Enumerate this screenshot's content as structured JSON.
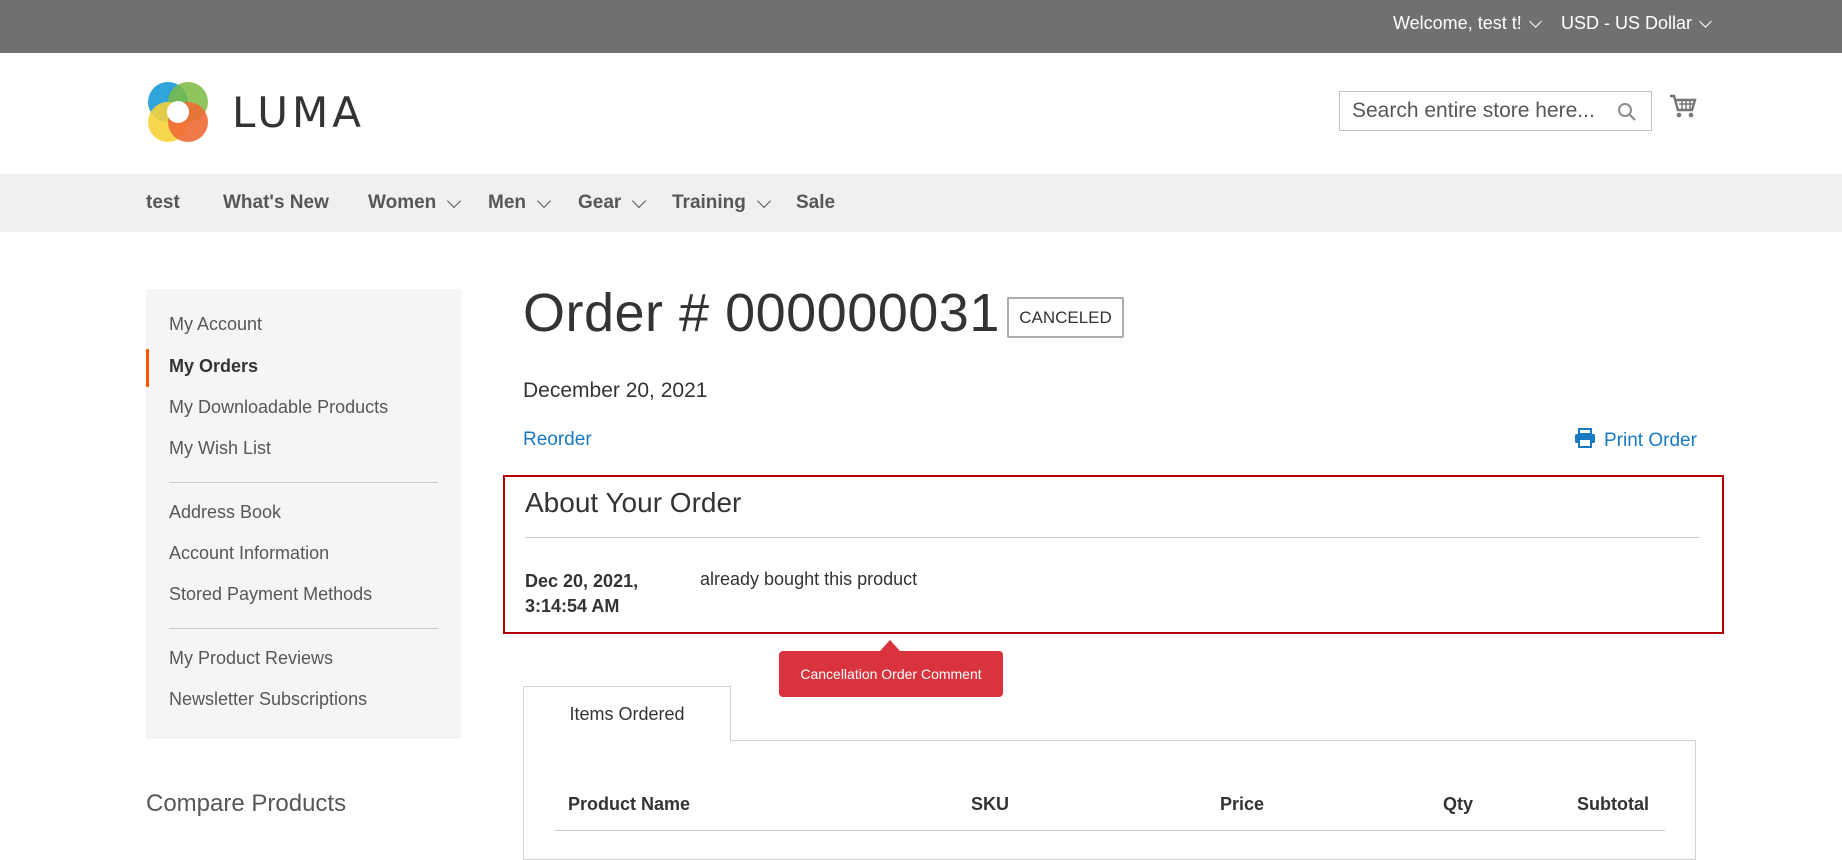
{
  "topbar": {
    "welcome": "Welcome, test t!",
    "currency": "USD - US Dollar"
  },
  "header": {
    "logo_text": "LUMA",
    "search_placeholder": "Search entire store here..."
  },
  "nav": {
    "items": [
      {
        "label": "test",
        "has_submenu": false
      },
      {
        "label": "What's New",
        "has_submenu": false
      },
      {
        "label": "Women",
        "has_submenu": true
      },
      {
        "label": "Men",
        "has_submenu": true
      },
      {
        "label": "Gear",
        "has_submenu": true
      },
      {
        "label": "Training",
        "has_submenu": true
      },
      {
        "label": "Sale",
        "has_submenu": false
      }
    ]
  },
  "sidebar": {
    "items": [
      {
        "label": "My Account"
      },
      {
        "label": "My Orders",
        "active": true
      },
      {
        "label": "My Downloadable Products"
      },
      {
        "label": "My Wish List"
      },
      {
        "label": "Address Book"
      },
      {
        "label": "Account Information"
      },
      {
        "label": "Stored Payment Methods"
      },
      {
        "label": "My Product Reviews"
      },
      {
        "label": "Newsletter Subscriptions"
      }
    ],
    "compare_title": "Compare Products"
  },
  "order": {
    "title": "Order # 000000031",
    "status": "CANCELED",
    "date": "December 20, 2021",
    "reorder_label": "Reorder",
    "print_label": "Print Order"
  },
  "about": {
    "title": "About Your Order",
    "comment_date_line1": "Dec 20, 2021,",
    "comment_date_line2": "3:14:54 AM",
    "comment_text": "already bought this product"
  },
  "tooltip": {
    "text": "Cancellation Order Comment"
  },
  "items": {
    "tab_label": "Items Ordered",
    "columns": [
      "Product Name",
      "SKU",
      "Price",
      "Qty",
      "Subtotal"
    ]
  },
  "colors": {
    "topbar_bg": "#6e716e",
    "link": "#1979c3",
    "active_accent": "#ff5501",
    "highlight_border": "#b30000",
    "tooltip_bg": "#d9333d"
  }
}
